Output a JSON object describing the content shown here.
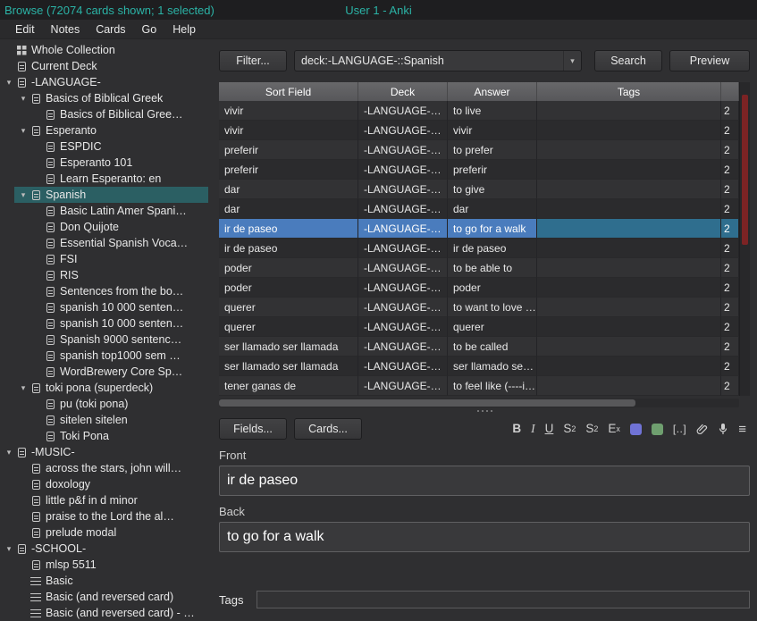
{
  "titlebar": {
    "title": "Browse (72074 cards shown; 1 selected)",
    "app": "User 1 - Anki"
  },
  "menubar": {
    "items": [
      "Edit",
      "Notes",
      "Cards",
      "Go",
      "Help"
    ]
  },
  "sidebar": {
    "items": [
      {
        "label": "Whole Collection",
        "indent": 0,
        "icon": "collection",
        "chevron": false,
        "selected": false
      },
      {
        "label": "Current Deck",
        "indent": 0,
        "icon": "deck",
        "chevron": false,
        "selected": false
      },
      {
        "label": "-LANGUAGE-",
        "indent": 0,
        "icon": "deck",
        "chevron": true,
        "selected": false
      },
      {
        "label": "Basics of Biblical Greek",
        "indent": 1,
        "icon": "deck",
        "chevron": true,
        "selected": false
      },
      {
        "label": "Basics of Biblical Gree…",
        "indent": 2,
        "icon": "deck",
        "chevron": false,
        "selected": false
      },
      {
        "label": "Esperanto",
        "indent": 1,
        "icon": "deck",
        "chevron": true,
        "selected": false
      },
      {
        "label": "ESPDIC",
        "indent": 2,
        "icon": "deck",
        "chevron": false,
        "selected": false
      },
      {
        "label": "Esperanto 101",
        "indent": 2,
        "icon": "deck",
        "chevron": false,
        "selected": false
      },
      {
        "label": "Learn Esperanto: en",
        "indent": 2,
        "icon": "deck",
        "chevron": false,
        "selected": false
      },
      {
        "label": "Spanish",
        "indent": 1,
        "icon": "deck",
        "chevron": true,
        "selected": true
      },
      {
        "label": "Basic Latin Amer Spani…",
        "indent": 2,
        "icon": "deck",
        "chevron": false,
        "selected": false
      },
      {
        "label": "Don Quijote",
        "indent": 2,
        "icon": "deck",
        "chevron": false,
        "selected": false
      },
      {
        "label": "Essential Spanish Voca…",
        "indent": 2,
        "icon": "deck",
        "chevron": false,
        "selected": false
      },
      {
        "label": "FSI",
        "indent": 2,
        "icon": "deck",
        "chevron": false,
        "selected": false
      },
      {
        "label": "RIS",
        "indent": 2,
        "icon": "deck",
        "chevron": false,
        "selected": false
      },
      {
        "label": "Sentences from the bo…",
        "indent": 2,
        "icon": "deck",
        "chevron": false,
        "selected": false
      },
      {
        "label": "spanish 10 000 senten…",
        "indent": 2,
        "icon": "deck",
        "chevron": false,
        "selected": false
      },
      {
        "label": "spanish 10 000 senten…",
        "indent": 2,
        "icon": "deck",
        "chevron": false,
        "selected": false
      },
      {
        "label": "Spanish 9000 sentenc…",
        "indent": 2,
        "icon": "deck",
        "chevron": false,
        "selected": false
      },
      {
        "label": "spanish top1000 sem …",
        "indent": 2,
        "icon": "deck",
        "chevron": false,
        "selected": false
      },
      {
        "label": "WordBrewery Core Sp…",
        "indent": 2,
        "icon": "deck",
        "chevron": false,
        "selected": false
      },
      {
        "label": "toki pona (superdeck)",
        "indent": 1,
        "icon": "deck",
        "chevron": true,
        "selected": false
      },
      {
        "label": "pu (toki pona)",
        "indent": 2,
        "icon": "deck",
        "chevron": false,
        "selected": false
      },
      {
        "label": "sitelen sitelen",
        "indent": 2,
        "icon": "deck",
        "chevron": false,
        "selected": false
      },
      {
        "label": "Toki Pona",
        "indent": 2,
        "icon": "deck",
        "chevron": false,
        "selected": false
      },
      {
        "label": "-MUSIC-",
        "indent": 0,
        "icon": "deck",
        "chevron": true,
        "selected": false
      },
      {
        "label": "across the stars, john will…",
        "indent": 1,
        "icon": "deck",
        "chevron": false,
        "selected": false
      },
      {
        "label": "doxology",
        "indent": 1,
        "icon": "deck",
        "chevron": false,
        "selected": false
      },
      {
        "label": "little p&f in d minor",
        "indent": 1,
        "icon": "deck",
        "chevron": false,
        "selected": false
      },
      {
        "label": "praise to the Lord the al…",
        "indent": 1,
        "icon": "deck",
        "chevron": false,
        "selected": false
      },
      {
        "label": "prelude modal",
        "indent": 1,
        "icon": "deck",
        "chevron": false,
        "selected": false
      },
      {
        "label": "-SCHOOL-",
        "indent": 0,
        "icon": "deck",
        "chevron": true,
        "selected": false
      },
      {
        "label": "mlsp 5511",
        "indent": 1,
        "icon": "deck",
        "chevron": false,
        "selected": false
      },
      {
        "label": "Basic",
        "indent": 1,
        "icon": "notetype",
        "chevron": false,
        "selected": false
      },
      {
        "label": "Basic (and reversed card)",
        "indent": 1,
        "icon": "notetype",
        "chevron": false,
        "selected": false
      },
      {
        "label": "Basic (and reversed card) - …",
        "indent": 1,
        "icon": "notetype",
        "chevron": false,
        "selected": false
      }
    ]
  },
  "toolbar": {
    "filter_label": "Filter...",
    "search_value": "deck:-LANGUAGE-::Spanish",
    "search_label": "Search",
    "preview_label": "Preview"
  },
  "table": {
    "columns": [
      "Sort Field",
      "Deck",
      "Answer",
      "Tags"
    ],
    "rows": [
      {
        "sort_field": "vivir",
        "deck": "-LANGUAGE-…",
        "answer": "to live",
        "tags": "",
        "due": "2",
        "selected": false
      },
      {
        "sort_field": "vivir",
        "deck": "-LANGUAGE-…",
        "answer": "vivir",
        "tags": "",
        "due": "2",
        "selected": false
      },
      {
        "sort_field": "preferir",
        "deck": "-LANGUAGE-…",
        "answer": "to prefer",
        "tags": "",
        "due": "2",
        "selected": false
      },
      {
        "sort_field": "preferir",
        "deck": "-LANGUAGE-…",
        "answer": "preferir",
        "tags": "",
        "due": "2",
        "selected": false
      },
      {
        "sort_field": "dar",
        "deck": "-LANGUAGE-…",
        "answer": "to give",
        "tags": "",
        "due": "2",
        "selected": false
      },
      {
        "sort_field": "dar",
        "deck": "-LANGUAGE-…",
        "answer": "dar",
        "tags": "",
        "due": "2",
        "selected": false
      },
      {
        "sort_field": "ir de paseo",
        "deck": "-LANGUAGE-…",
        "answer": "to go for a walk",
        "tags": "",
        "due": "2",
        "selected": true
      },
      {
        "sort_field": "ir de paseo",
        "deck": "-LANGUAGE-…",
        "answer": "ir de paseo",
        "tags": "",
        "due": "2",
        "selected": false
      },
      {
        "sort_field": "poder",
        "deck": "-LANGUAGE-…",
        "answer": "to be able to",
        "tags": "",
        "due": "2",
        "selected": false
      },
      {
        "sort_field": "poder",
        "deck": "-LANGUAGE-…",
        "answer": "poder",
        "tags": "",
        "due": "2",
        "selected": false
      },
      {
        "sort_field": "querer",
        "deck": "-LANGUAGE-…",
        "answer": "to want to love …",
        "tags": "",
        "due": "2",
        "selected": false
      },
      {
        "sort_field": "querer",
        "deck": "-LANGUAGE-…",
        "answer": "querer",
        "tags": "",
        "due": "2",
        "selected": false
      },
      {
        "sort_field": "ser llamado ser llamada",
        "deck": "-LANGUAGE-…",
        "answer": "to be called",
        "tags": "",
        "due": "2",
        "selected": false
      },
      {
        "sort_field": "ser llamado ser llamada",
        "deck": "-LANGUAGE-…",
        "answer": "ser llamado se…",
        "tags": "",
        "due": "2",
        "selected": false
      },
      {
        "sort_field": "tener ganas de",
        "deck": "-LANGUAGE-…",
        "answer": "to feel like (----i…",
        "tags": "",
        "due": "2",
        "selected": false
      }
    ]
  },
  "editor": {
    "fields_label": "Fields...",
    "cards_label": "Cards...",
    "toolbar_icons": [
      {
        "name": "bold",
        "glyph": "B"
      },
      {
        "name": "italic",
        "glyph": "I"
      },
      {
        "name": "underline",
        "glyph": "U"
      },
      {
        "name": "superscript",
        "glyph": "S",
        "sup": "2"
      },
      {
        "name": "subscript",
        "glyph": "S",
        "sub": "2"
      },
      {
        "name": "remove-formatting",
        "glyph": "E",
        "sub": "x"
      },
      {
        "name": "text-color",
        "type": "swatch",
        "color": "#7073d6"
      },
      {
        "name": "highlight-color",
        "type": "swatch",
        "color": "#6f9f6f"
      },
      {
        "name": "cloze",
        "glyph": "[..]"
      },
      {
        "name": "attach",
        "type": "svg",
        "svg": "paperclip"
      },
      {
        "name": "record-audio",
        "type": "svg",
        "svg": "microphone"
      },
      {
        "name": "more-options",
        "glyph": "≡"
      }
    ],
    "fields": [
      {
        "label": "Front",
        "value": "ir de paseo"
      },
      {
        "label": "Back",
        "value": "to go for a walk"
      }
    ],
    "tags_label": "Tags",
    "tags_value": ""
  },
  "colors": {
    "accent_teal": "#2bb3a6",
    "row_selection_blue": "#4a7cbd",
    "sidebar_selection_teal": "#2b5f63",
    "vertical_scrollbar_thumb": "#7c2324"
  }
}
